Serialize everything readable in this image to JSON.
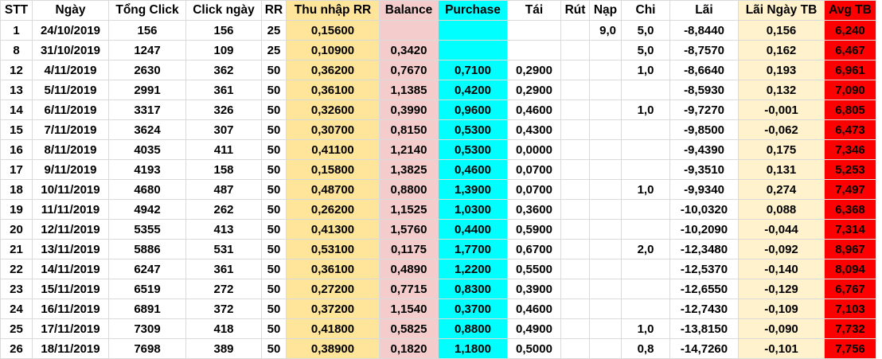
{
  "colors": {
    "thu_nhap_rr": "#ffe599",
    "balance": "#f4cccc",
    "purchase": "#00ffff",
    "lai_ngay_tb": "#fff2cc",
    "avg_tb": "#ff0000"
  },
  "headers": [
    "STT",
    "Ngày",
    "Tổng Click",
    "Click ngày",
    "RR",
    "Thu nhập RR",
    "Balance",
    "Purchase",
    "Tái",
    "Rút",
    "Nạp",
    "Chi",
    "Lãi",
    "Lãi Ngày TB",
    "Avg TB"
  ],
  "rows": [
    [
      "1",
      "24/10/2019",
      "156",
      "156",
      "25",
      "0,15600",
      "",
      "",
      "",
      "",
      "9,0",
      "5,0",
      "-8,8440",
      "0,156",
      "6,240"
    ],
    [
      "8",
      "31/10/2019",
      "1247",
      "109",
      "25",
      "0,10900",
      "0,3420",
      "",
      "",
      "",
      "",
      "5,0",
      "-8,7570",
      "0,162",
      "6,467"
    ],
    [
      "12",
      "4/11/2019",
      "2630",
      "362",
      "50",
      "0,36200",
      "0,7670",
      "0,7100",
      "0,2900",
      "",
      "",
      "1,0",
      "-8,6640",
      "0,193",
      "6,961"
    ],
    [
      "13",
      "5/11/2019",
      "2991",
      "361",
      "50",
      "0,36100",
      "1,1385",
      "0,4200",
      "0,2900",
      "",
      "",
      "",
      "-8,5930",
      "0,132",
      "7,090"
    ],
    [
      "14",
      "6/11/2019",
      "3317",
      "326",
      "50",
      "0,32600",
      "0,3990",
      "0,9600",
      "0,4600",
      "",
      "",
      "1,0",
      "-9,7270",
      "-0,001",
      "6,805"
    ],
    [
      "15",
      "7/11/2019",
      "3624",
      "307",
      "50",
      "0,30700",
      "0,8150",
      "0,5300",
      "0,4300",
      "",
      "",
      "",
      "-9,8500",
      "-0,062",
      "6,473"
    ],
    [
      "16",
      "8/11/2019",
      "4035",
      "411",
      "50",
      "0,41100",
      "1,2140",
      "0,5300",
      "0,0000",
      "",
      "",
      "",
      "-9,4390",
      "0,175",
      "7,346"
    ],
    [
      "17",
      "9/11/2019",
      "4193",
      "158",
      "50",
      "0,15800",
      "1,3825",
      "0,4600",
      "0,0700",
      "",
      "",
      "",
      "-9,3510",
      "0,131",
      "5,253"
    ],
    [
      "18",
      "10/11/2019",
      "4680",
      "487",
      "50",
      "0,48700",
      "0,8800",
      "1,3900",
      "0,0700",
      "",
      "",
      "1,0",
      "-9,9340",
      "0,274",
      "7,497"
    ],
    [
      "19",
      "11/11/2019",
      "4942",
      "262",
      "50",
      "0,26200",
      "1,1525",
      "1,0300",
      "0,3600",
      "",
      "",
      "",
      "-10,0320",
      "0,088",
      "6,368"
    ],
    [
      "20",
      "12/11/2019",
      "5355",
      "413",
      "50",
      "0,41300",
      "1,5760",
      "0,4400",
      "0,5900",
      "",
      "",
      "",
      "-10,2090",
      "-0,044",
      "7,314"
    ],
    [
      "21",
      "13/11/2019",
      "5886",
      "531",
      "50",
      "0,53100",
      "0,1175",
      "1,7700",
      "0,6700",
      "",
      "",
      "2,0",
      "-12,3480",
      "-0,092",
      "8,967"
    ],
    [
      "22",
      "14/11/2019",
      "6247",
      "361",
      "50",
      "0,36100",
      "0,4890",
      "1,2200",
      "0,5500",
      "",
      "",
      "",
      "-12,5370",
      "-0,140",
      "8,094"
    ],
    [
      "23",
      "15/11/2019",
      "6519",
      "272",
      "50",
      "0,27200",
      "0,7715",
      "0,8300",
      "0,3900",
      "",
      "",
      "",
      "-12,6550",
      "-0,129",
      "6,767"
    ],
    [
      "24",
      "16/11/2019",
      "6891",
      "372",
      "50",
      "0,37200",
      "1,1540",
      "0,3700",
      "0,4600",
      "",
      "",
      "",
      "-12,7430",
      "-0,109",
      "7,103"
    ],
    [
      "25",
      "17/11/2019",
      "7309",
      "418",
      "50",
      "0,41800",
      "0,5825",
      "0,8800",
      "0,4900",
      "",
      "",
      "1,0",
      "-13,8150",
      "-0,090",
      "7,732"
    ],
    [
      "26",
      "18/11/2019",
      "7698",
      "389",
      "50",
      "0,38900",
      "0,1820",
      "1,1800",
      "0,5000",
      "",
      "",
      "0,8",
      "-14,7260",
      "-0,101",
      "7,756"
    ]
  ]
}
